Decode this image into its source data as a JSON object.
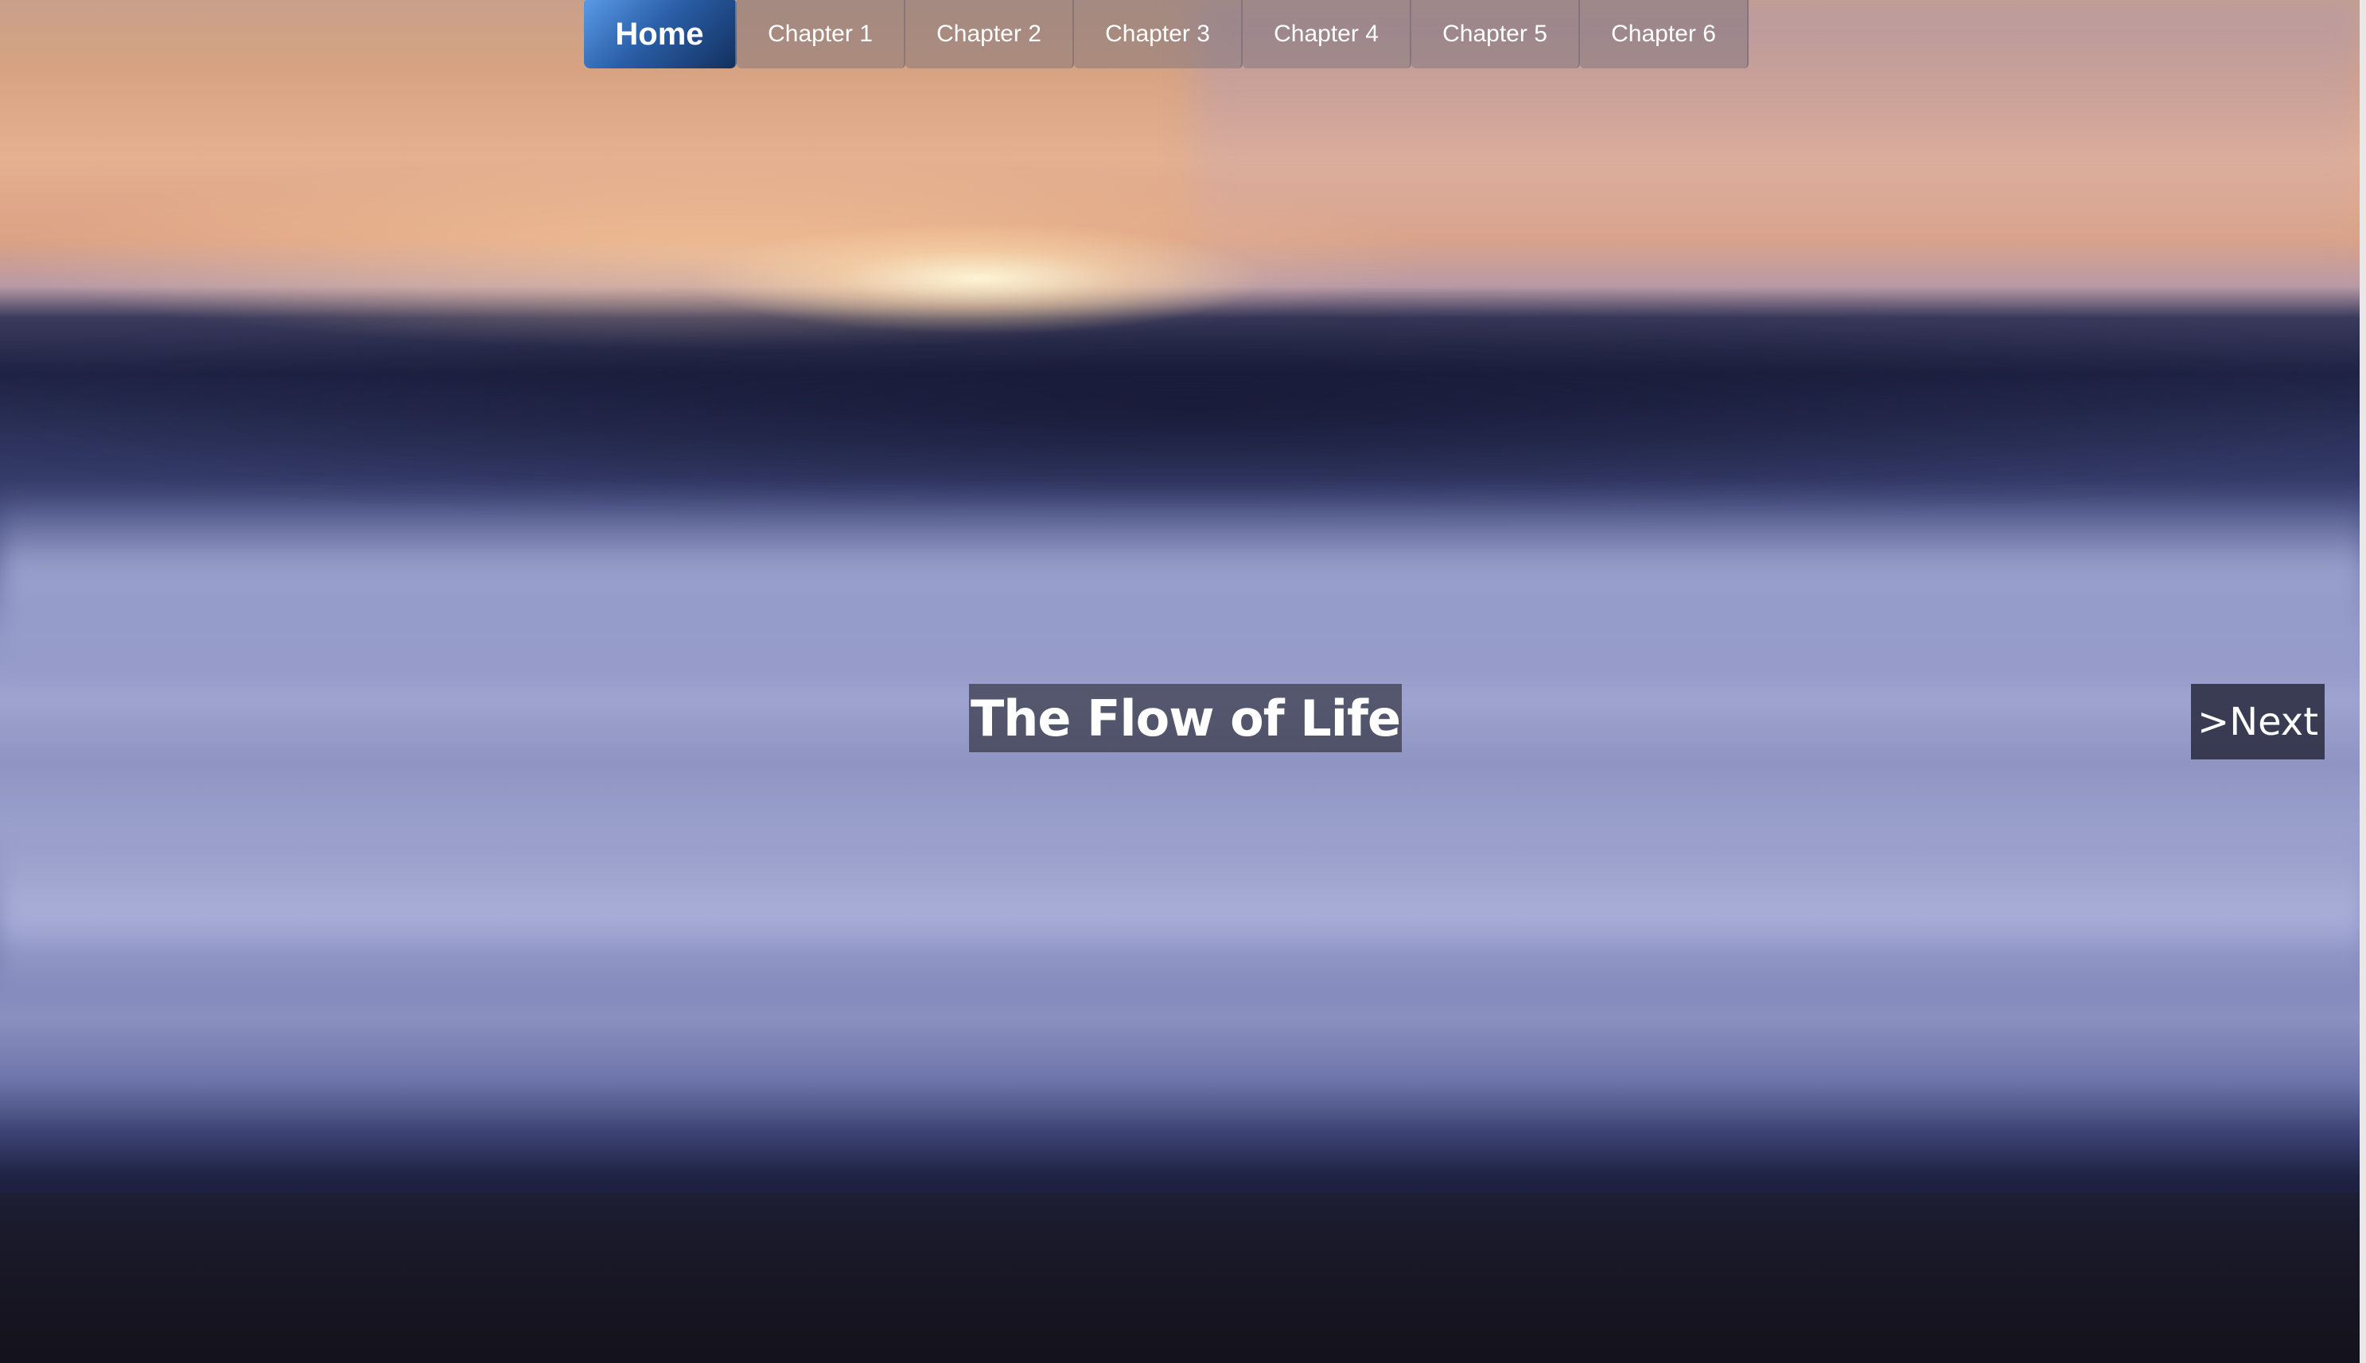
{
  "nav": {
    "items": [
      {
        "label": "Home"
      },
      {
        "label": "Chapter 1"
      },
      {
        "label": "Chapter 2"
      },
      {
        "label": "Chapter 3"
      },
      {
        "label": "Chapter 4"
      },
      {
        "label": "Chapter 5"
      },
      {
        "label": "Chapter 6"
      }
    ]
  },
  "hero": {
    "title": "The Flow of Life",
    "next_label": ">Next"
  },
  "colors": {
    "home_accent": "#2a5fa8",
    "overlay": "#28283a"
  }
}
